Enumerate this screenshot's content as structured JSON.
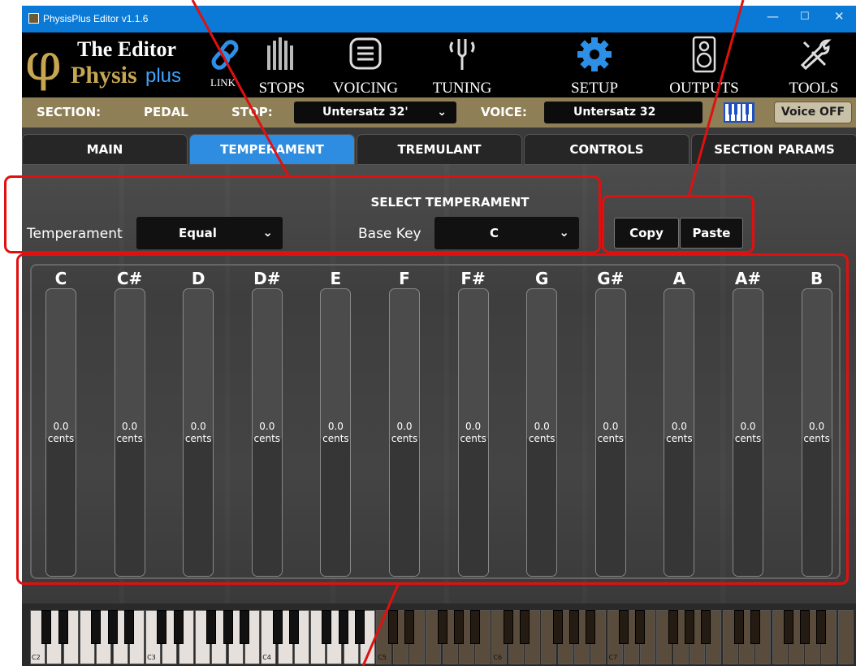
{
  "window": {
    "title": "PhysisPlus Editor v1.1.6"
  },
  "logo": {
    "phi": "φ",
    "line1": "The Editor",
    "line2": "Physis",
    "line3": "plus",
    "link_label": "LINK"
  },
  "toolbar": {
    "items": [
      {
        "label": "STOPS",
        "icon": "organ-pipes-icon"
      },
      {
        "label": "VOICING",
        "icon": "list-icon"
      },
      {
        "label": "TUNING",
        "icon": "tuning-fork-icon"
      },
      {
        "label": "SETUP",
        "icon": "gear-icon"
      },
      {
        "label": "OUTPUTS",
        "icon": "speaker-icon"
      },
      {
        "label": "TOOLS",
        "icon": "tools-icon"
      }
    ]
  },
  "section_bar": {
    "section_label": "SECTION:",
    "section_value": "PEDAL",
    "stop_label": "STOP:",
    "stop_value": "Untersatz 32'",
    "voice_label": "VOICE:",
    "voice_value": "Untersatz 32",
    "voice_off_label": "Voice OFF"
  },
  "tabs": [
    {
      "label": "MAIN",
      "active": false
    },
    {
      "label": "TEMPERAMENT",
      "active": true
    },
    {
      "label": "TREMULANT",
      "active": false
    },
    {
      "label": "CONTROLS",
      "active": false
    },
    {
      "label": "SECTION PARAMS",
      "active": false
    }
  ],
  "temperament": {
    "title": "SELECT TEMPERAMENT",
    "temperament_label": "Temperament",
    "temperament_value": "Equal",
    "base_key_label": "Base Key",
    "base_key_value": "C",
    "copy_label": "Copy",
    "paste_label": "Paste"
  },
  "notes": [
    {
      "name": "C",
      "value": "0.0",
      "unit": "cents"
    },
    {
      "name": "C#",
      "value": "0.0",
      "unit": "cents"
    },
    {
      "name": "D",
      "value": "0.0",
      "unit": "cents"
    },
    {
      "name": "D#",
      "value": "0.0",
      "unit": "cents"
    },
    {
      "name": "E",
      "value": "0.0",
      "unit": "cents"
    },
    {
      "name": "F",
      "value": "0.0",
      "unit": "cents"
    },
    {
      "name": "F#",
      "value": "0.0",
      "unit": "cents"
    },
    {
      "name": "G",
      "value": "0.0",
      "unit": "cents"
    },
    {
      "name": "G#",
      "value": "0.0",
      "unit": "cents"
    },
    {
      "name": "A",
      "value": "0.0",
      "unit": "cents"
    },
    {
      "name": "A#",
      "value": "0.0",
      "unit": "cents"
    },
    {
      "name": "B",
      "value": "0.0",
      "unit": "cents"
    }
  ],
  "slider_level": 0.5,
  "keyboard": {
    "octave_labels": [
      "C2",
      "C3",
      "C4",
      "C5",
      "C6",
      "C7"
    ]
  },
  "colors": {
    "accent": "#2e8de0",
    "gold": "#c7a652",
    "section_bar": "#8f7f56",
    "annotation": "#e01010"
  }
}
